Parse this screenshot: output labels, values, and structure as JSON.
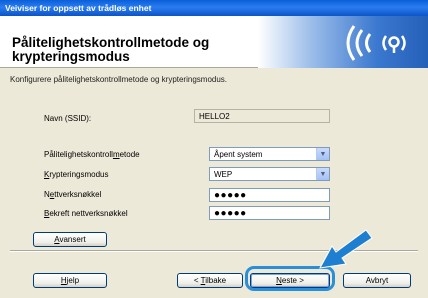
{
  "window": {
    "title": "Veiviser for oppsett av trådløs enhet"
  },
  "header": {
    "title": "Pålitelighetskontrollmetode og krypteringsmodus"
  },
  "subtitle": "Konfigurere pålitelighetskontrollmetode og krypteringsmodus.",
  "form": {
    "ssid": {
      "label": "Navn (SSID):",
      "value": "HELLO2"
    },
    "auth": {
      "label": "Pålitelighetskontrollmetode",
      "value": "Åpent system"
    },
    "encryption": {
      "label": "Krypteringsmodus",
      "value": "WEP"
    },
    "key": {
      "label": "Nettverksnøkkel",
      "value": "●●●●●"
    },
    "confirm_key": {
      "label": "Bekreft nettverksnøkkel",
      "value": "●●●●●"
    }
  },
  "buttons": {
    "advanced": "Avansert",
    "help": "Hjelp",
    "back": "< Tilbake",
    "next": "Neste >",
    "cancel": "Avbryt"
  },
  "colors": {
    "titlebar": "#0a5fd8",
    "highlight": "#2b8fd8",
    "arrow": "#1e7fd0"
  }
}
